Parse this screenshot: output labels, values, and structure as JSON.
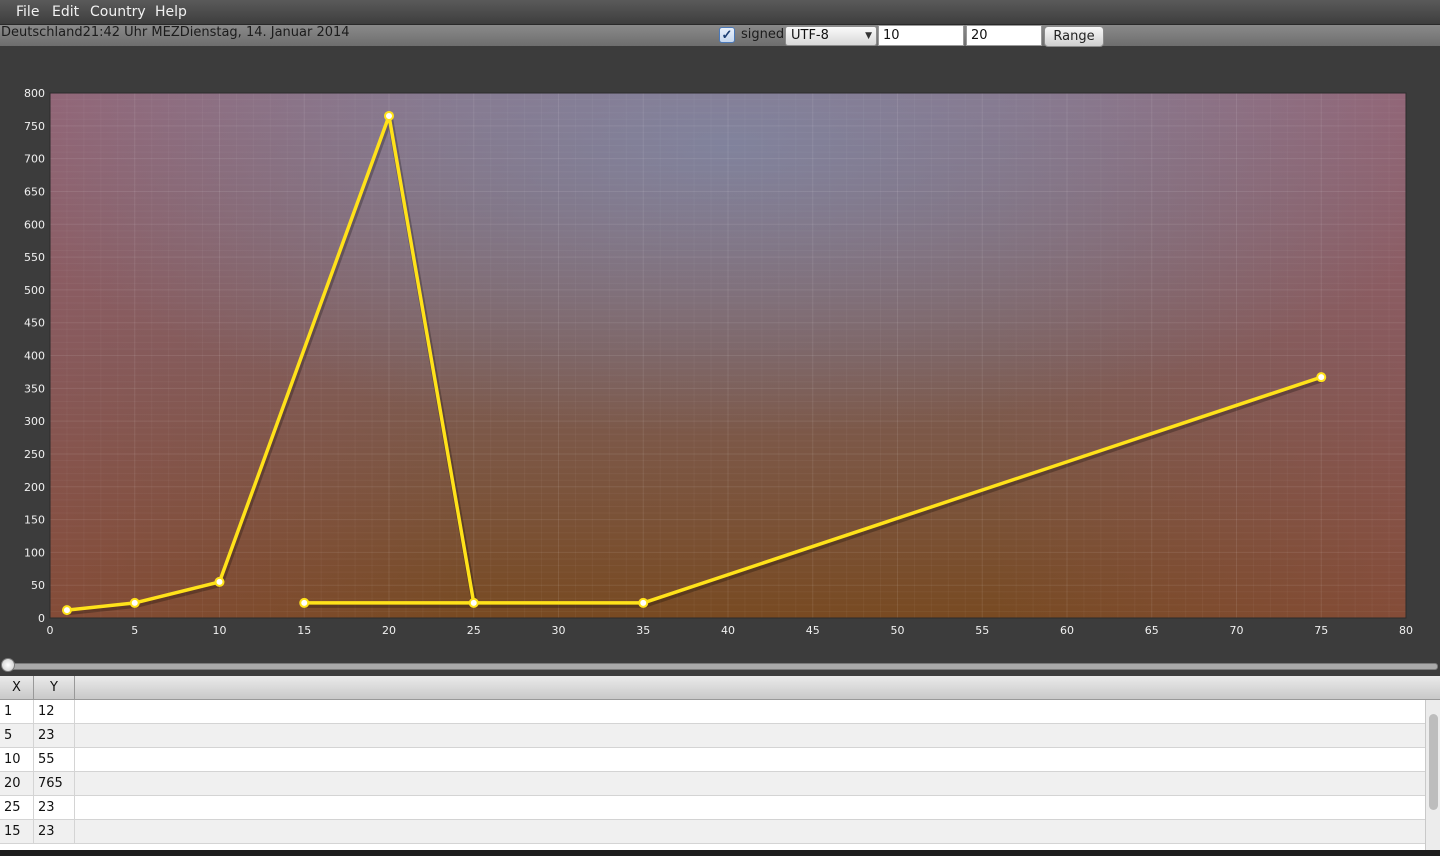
{
  "menu": {
    "items": [
      "File",
      "Edit",
      "Country",
      "Help"
    ]
  },
  "toolbar": {
    "status_text": "Deutschland21:42 Uhr MEZDienstag, 14. Januar 2014",
    "signed_checked": true,
    "signed_label": "signed",
    "encoding_value": "UTF-8",
    "range_from": "10",
    "range_to": "20",
    "range_button": "Range"
  },
  "chart_data": {
    "type": "line",
    "x": [
      1,
      5,
      10,
      20,
      25,
      15,
      35,
      75
    ],
    "y": [
      12,
      23,
      55,
      765,
      23,
      23,
      23,
      367
    ],
    "xlim": [
      0,
      80
    ],
    "ylim": [
      0,
      800
    ],
    "xticks": [
      0,
      5,
      10,
      15,
      20,
      25,
      30,
      35,
      40,
      45,
      50,
      55,
      60,
      65,
      70,
      75,
      80
    ],
    "yticks": [
      0,
      50,
      100,
      150,
      200,
      250,
      300,
      350,
      400,
      450,
      500,
      550,
      600,
      650,
      700,
      750,
      800
    ],
    "line_color": "#ffe21a",
    "grid": true
  },
  "table": {
    "columns": [
      "X",
      "Y"
    ],
    "rows": [
      [
        "1",
        "12"
      ],
      [
        "5",
        "23"
      ],
      [
        "10",
        "55"
      ],
      [
        "20",
        "765"
      ],
      [
        "25",
        "23"
      ],
      [
        "15",
        "23"
      ]
    ]
  }
}
